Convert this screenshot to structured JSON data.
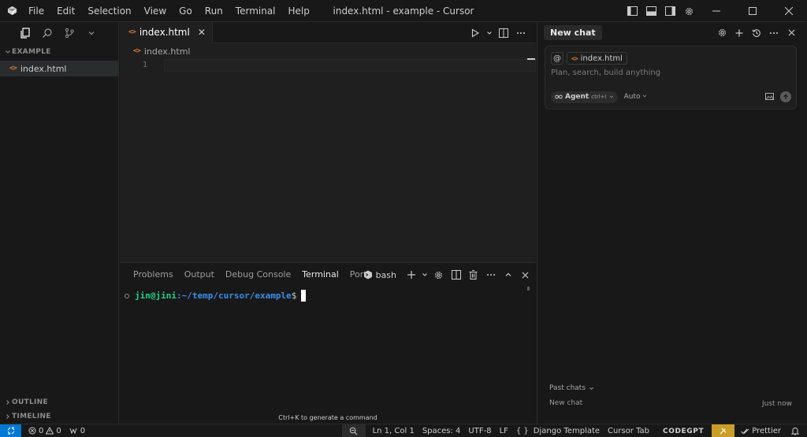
{
  "titlebar": {
    "menu": [
      "File",
      "Edit",
      "Selection",
      "View",
      "Go",
      "Run",
      "Terminal",
      "Help"
    ],
    "window_title": "index.html - example - Cursor"
  },
  "sidebar": {
    "section_title": "EXAMPLE",
    "files": [
      {
        "name": "index.html",
        "icon": "html-file-icon"
      }
    ],
    "outline_label": "OUTLINE",
    "timeline_label": "TIMELINE"
  },
  "editor": {
    "tab_label": "index.html",
    "breadcrumb": "index.html",
    "line_numbers": [
      "1"
    ]
  },
  "panel": {
    "tabs": [
      "Problems",
      "Output",
      "Debug Console",
      "Terminal",
      "Ports"
    ],
    "active_tab": "Terminal",
    "shell_label": "bash",
    "prompt_user": "jin@jini",
    "prompt_path": ":~/temp/cursor/example",
    "prompt_symbol": "$",
    "hint": "Ctrl+K to generate a command"
  },
  "chat": {
    "title": "New chat",
    "context_at": "@",
    "context_file": "index.html",
    "input_placeholder": "Plan, search, build anything",
    "mode_label": "Agent",
    "mode_shortcut": "ctrl+I",
    "model_label": "Auto",
    "past_chats_label": "Past chats",
    "past_items": [
      {
        "title": "New chat",
        "time": "Just now"
      }
    ]
  },
  "statusbar": {
    "errors": "0",
    "warnings": "0",
    "ports": "0",
    "cursor_position": "Ln 1, Col 1",
    "indent": "Spaces: 4",
    "encoding": "UTF-8",
    "eol": "LF",
    "language": "Django Template",
    "cursor_tab": "Cursor Tab",
    "codegpt": "CODEGPT",
    "prettier": "Prettier"
  },
  "colors": {
    "background": "#181818",
    "editor_bg": "#1f1f1f",
    "accent_blue": "#0078d4",
    "html_icon": "#e37933",
    "terminal_user": "#23d18b",
    "terminal_path": "#3b8eea",
    "status_highlight": "#c89e27"
  }
}
